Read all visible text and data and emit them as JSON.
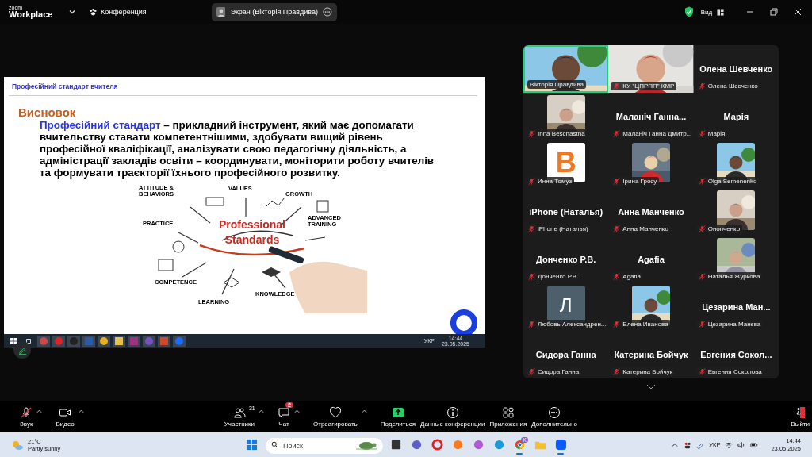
{
  "top_bar": {
    "brand_small": "zoom",
    "brand": "Workplace",
    "meeting_label": "Конференция",
    "share_pill": "Экран (Вікторія Правдива)",
    "view_label": "Вид"
  },
  "shared_screen": {
    "slide": {
      "header": "Професійний стандарт вчителя",
      "heading": "Висновок",
      "term": "Професійний стандарт",
      "text": "– прикладний інструмент, який має допомагати вчительству ставати компетентнішими, здобувати вищий рівень професійної кваліфікації, аналізувати свою педагогічну діяльність, а адміністрації закладів освіти – координувати, моніторити роботу вчителів та формувати траєкторії їхнього професійного розвитку.",
      "diagram_labels": [
        {
          "kind": "spoke",
          "text": "ATTITUDE & BEHAVIORS"
        },
        {
          "kind": "spoke",
          "text": "VALUES"
        },
        {
          "kind": "spoke",
          "text": "GROWTH"
        },
        {
          "kind": "spoke",
          "text": "PRACTICE"
        },
        {
          "kind": "center",
          "text": "Professional Standards"
        },
        {
          "kind": "spoke",
          "text": "ADVANCED TRAINING"
        },
        {
          "kind": "spoke",
          "text": "COMPETENCE"
        },
        {
          "kind": "spoke",
          "text": "LEARNING"
        },
        {
          "kind": "spoke",
          "text": "KNOWLEDGE"
        }
      ]
    },
    "taskbar": {
      "apps": [
        {
          "kind": "start"
        },
        {
          "kind": "taskview"
        },
        {
          "kind": "globe"
        },
        {
          "kind": "opera"
        },
        {
          "kind": "triangle"
        },
        {
          "kind": "word"
        },
        {
          "kind": "chrome"
        },
        {
          "kind": "folder"
        },
        {
          "kind": "archive"
        },
        {
          "kind": "viber"
        },
        {
          "kind": "powerpoint"
        },
        {
          "kind": "zoom"
        }
      ],
      "language": "УКР",
      "time": "14:44",
      "date": "23.05.2025"
    }
  },
  "gallery": [
    {
      "name": "Вікторія Правдива",
      "kind": "video",
      "muted": false,
      "active_speaker": true
    },
    {
      "name": "КУ \"ЦПРПП\" КМР",
      "kind": "video",
      "muted": true,
      "active_speaker": false
    },
    {
      "name": "Олена Шевченко",
      "kind": "name",
      "title": "Олена Шевченко",
      "muted": true,
      "active_speaker": false
    },
    {
      "name": "Inna Beschastna",
      "muted": true,
      "active_speaker": false
    },
    {
      "name": "Маланіч Ганна Дмитр...",
      "kind": "name",
      "title": "Маланіч Ганна...",
      "muted": true,
      "active_speaker": false
    },
    {
      "name": "Марія",
      "kind": "name",
      "title": "Марія",
      "muted": true,
      "active_speaker": false
    },
    {
      "name": "Инна Томуз",
      "kind": "logo",
      "letter": "B",
      "muted": true,
      "active_speaker": false
    },
    {
      "name": "Ірина  Гросу",
      "muted": true,
      "active_speaker": false
    },
    {
      "name": "Olga Semenenko",
      "muted": true,
      "active_speaker": false
    },
    {
      "name": "iPhone (Наталья)",
      "kind": "name",
      "title": "iPhone (Наталья)",
      "muted": true,
      "active_speaker": false
    },
    {
      "name": "Анна Манченко",
      "kind": "name",
      "title": "Анна Манченко",
      "muted": true,
      "active_speaker": false
    },
    {
      "name": "Онопченко",
      "muted": true,
      "active_speaker": false
    },
    {
      "name": "Донченко Р.В.",
      "kind": "name",
      "title": "Донченко Р.В.",
      "muted": true,
      "active_speaker": false
    },
    {
      "name": "Agafia",
      "kind": "name",
      "title": "Agafia",
      "muted": true,
      "active_speaker": false
    },
    {
      "name": "Наталья Журкова",
      "muted": true,
      "active_speaker": false
    },
    {
      "name": "Любовь Александрен...",
      "kind": "letter",
      "letter": "Л",
      "muted": true,
      "active_speaker": false
    },
    {
      "name": "Елена Иванова",
      "muted": true,
      "active_speaker": false
    },
    {
      "name": "Цезарина Манєва",
      "kind": "name",
      "title": "Цезарина  Ман...",
      "muted": true,
      "active_speaker": false
    },
    {
      "name": "Сидора Ганна",
      "kind": "name",
      "title": "Сидора Ганна",
      "muted": true,
      "active_speaker": false
    },
    {
      "name": "Катерина Бойчук",
      "kind": "name",
      "title": "Катерина Бойчук",
      "muted": true,
      "active_speaker": false
    },
    {
      "name": "Евгения Соколова",
      "kind": "name",
      "title": "Евгения  Сокол...",
      "muted": true,
      "active_speaker": false
    }
  ],
  "toolbar": [
    {
      "kind": "audio",
      "label": "Звук",
      "muted": true,
      "caret": true
    },
    {
      "kind": "video",
      "label": "Видео",
      "caret": true
    },
    {
      "kind": "participants",
      "label": "Участники",
      "count": "31",
      "caret": true
    },
    {
      "kind": "chat",
      "label": "Чат",
      "badge": "2",
      "caret": true
    },
    {
      "kind": "react",
      "label": "Отреагировать",
      "caret": true
    },
    {
      "kind": "share",
      "label": "Поделиться",
      "caret": false
    },
    {
      "kind": "info",
      "label": "Данные конференции",
      "caret": false
    },
    {
      "kind": "apps",
      "label": "Приложения",
      "caret": false
    },
    {
      "kind": "more",
      "label": "Дополнительно",
      "caret": false
    },
    {
      "kind": "leave",
      "label": "Выйти",
      "caret": false
    }
  ],
  "windows_taskbar": {
    "temperature": "21°C",
    "weather": "Partly sunny",
    "search": {
      "placeholder": "Поиск"
    },
    "apps": [
      {
        "kind": "desktop",
        "running": false
      },
      {
        "kind": "teams",
        "running": false
      },
      {
        "kind": "opera",
        "running": false
      },
      {
        "kind": "firefox",
        "running": false
      },
      {
        "kind": "copilot",
        "running": false
      },
      {
        "kind": "edge",
        "running": false
      },
      {
        "kind": "chrome",
        "running": true,
        "badge": "K"
      },
      {
        "kind": "folder",
        "running": false
      },
      {
        "kind": "zoom",
        "running": true
      }
    ],
    "language": "УКР",
    "time": "14:44",
    "date": "23.05.2025"
  }
}
